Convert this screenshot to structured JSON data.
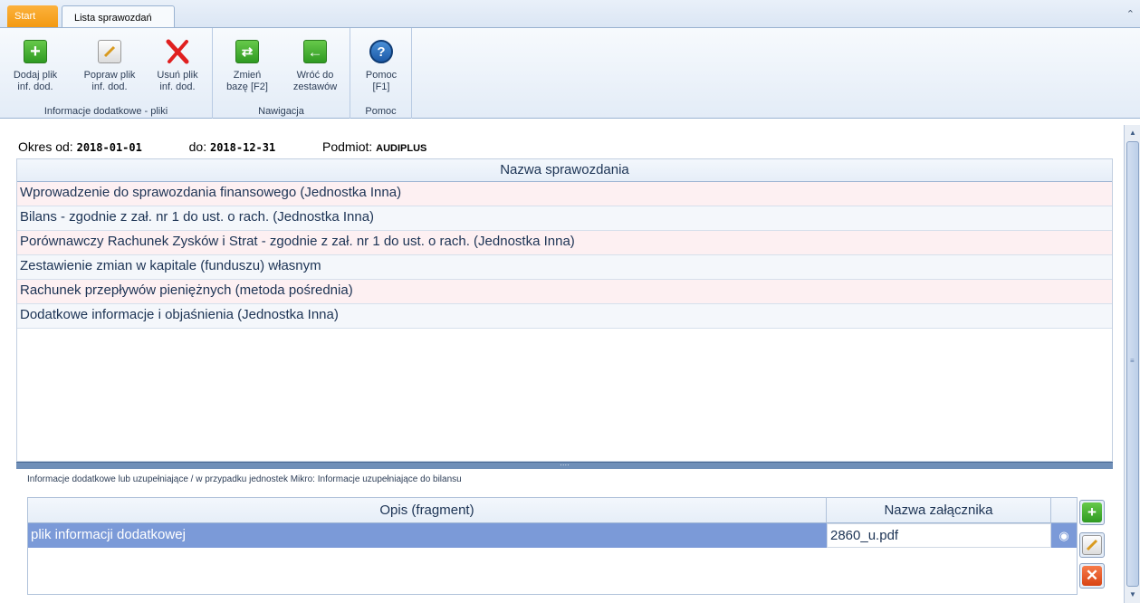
{
  "tabs": {
    "start": "Start",
    "lista": "Lista sprawozdań"
  },
  "ribbon": {
    "groups": [
      {
        "label": "Informacje dodatkowe - pliki"
      },
      {
        "label": "Nawigacja"
      },
      {
        "label": "Pomoc"
      }
    ],
    "buttons": {
      "dodaj": "Dodaj plik\ninf. dod.",
      "popraw": "Popraw plik\ninf. dod.",
      "usun": "Usuń plik\ninf. dod.",
      "zmien": "Zmień\nbazę [F2]",
      "wroc": "Wróć do\nzestawów",
      "pomoc": "Pomoc\n[F1]"
    }
  },
  "period": {
    "od_label": "Okres od:",
    "od_value": "2018-01-01",
    "do_label": "do:",
    "do_value": "2018-12-31",
    "podmiot_label": "Podmiot:",
    "podmiot_value": "AUDIPLUS"
  },
  "reports": {
    "header": "Nazwa sprawozdania",
    "rows": [
      "Wprowadzenie do sprawozdania finansowego (Jednostka Inna)",
      "Bilans - zgodnie z zał. nr 1 do ust. o rach. (Jednostka Inna)",
      "Porównawczy Rachunek Zysków i Strat - zgodnie z zał. nr 1 do ust. o rach. (Jednostka Inna)",
      "Zestawienie zmian w kapitale (funduszu) własnym",
      "Rachunek przepływów pieniężnych (metoda pośrednia)",
      "Dodatkowe informacje i objaśnienia (Jednostka Inna)"
    ]
  },
  "attachments": {
    "section_label": "Informacje dodatkowe lub uzupełniające / w przypadku jednostek Mikro: Informacje uzupełniające do bilansu",
    "col_opis": "Opis (fragment)",
    "col_nazwa": "Nazwa załącznika",
    "row_opis": "plik informacji dodatkowej",
    "row_nazwa": "2860_u.pdf"
  },
  "colors": {
    "accent": "#7b9ad8",
    "start_tab": "#f39a12",
    "row_pink": "#fdf0f2"
  }
}
